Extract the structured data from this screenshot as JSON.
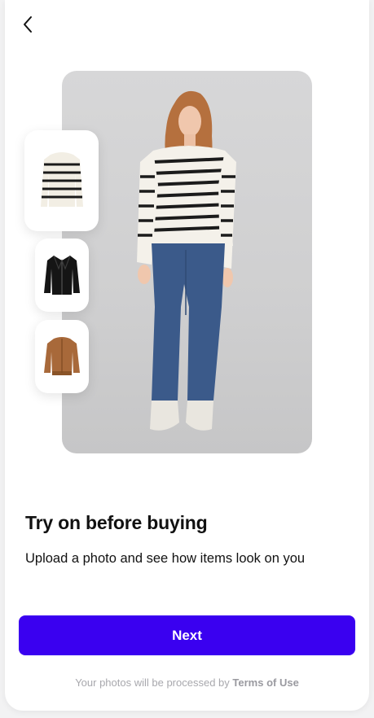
{
  "header": {
    "back_icon": "chevron-left-icon"
  },
  "hero": {
    "image": "model-wearing-striped-sweater-and-jeans"
  },
  "thumbnails": [
    {
      "item": "striped-sweater"
    },
    {
      "item": "black-leather-jacket"
    },
    {
      "item": "tan-bomber-jacket"
    }
  ],
  "content": {
    "title": "Try on before buying",
    "subtitle": "Upload a photo and see how items look on you"
  },
  "actions": {
    "next_label": "Next"
  },
  "footer": {
    "text": "Your photos will be processed by",
    "link": "Terms of Use"
  },
  "colors": {
    "accent": "#3a00f0",
    "background": "#ffffff",
    "muted_text": "#a8a8ad"
  }
}
